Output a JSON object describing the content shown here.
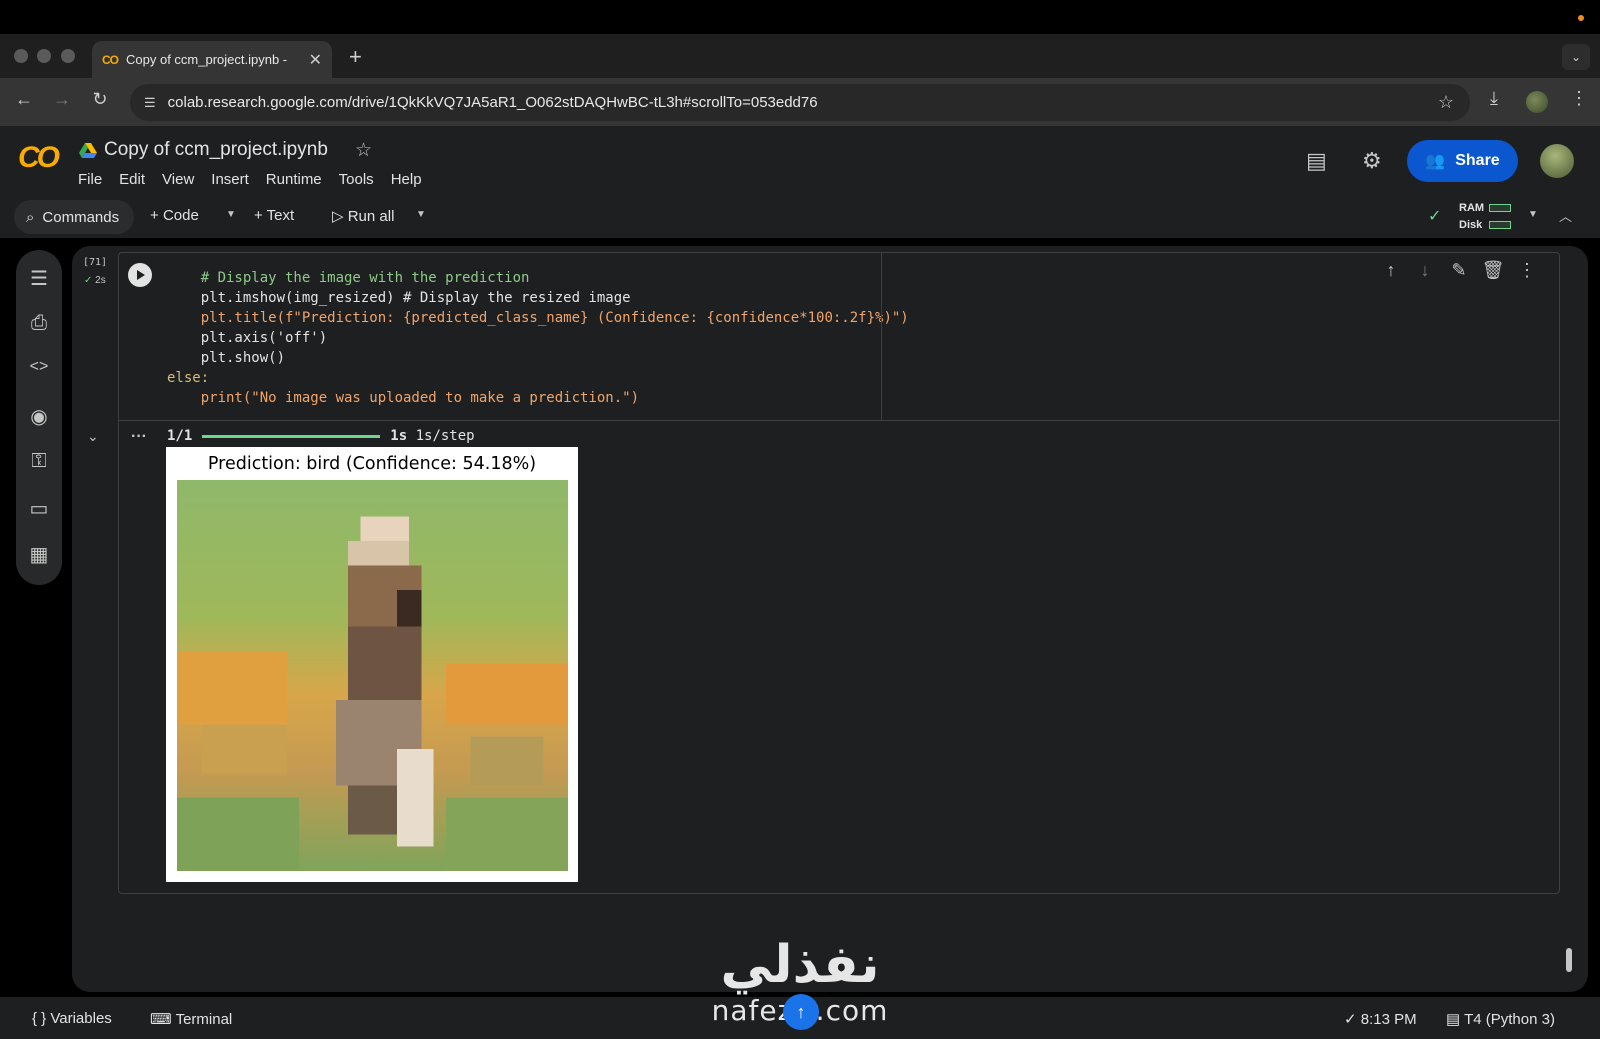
{
  "browser": {
    "tab_title": "Copy of ccm_project.ipynb -",
    "url": "colab.research.google.com/drive/1QkKkVQ7JA5aR1_O062stDAQHwBC-tL3h#scrollTo=053edd76"
  },
  "colab": {
    "logo": "CO",
    "notebook_title": "Copy of ccm_project.ipynb",
    "menu": [
      "File",
      "Edit",
      "View",
      "Insert",
      "Runtime",
      "Tools",
      "Help"
    ],
    "share_label": "Share",
    "toolbar": {
      "commands": "Commands",
      "code": "Code",
      "text": "Text",
      "run_all": "Run all",
      "ram": "RAM",
      "disk": "Disk"
    }
  },
  "cell": {
    "exec_count": "[71]",
    "exec_time": "2s",
    "code_lines": [
      "    # Display the image with the prediction",
      "    plt.imshow(img_resized) # Display the resized image",
      "    plt.title(f\"Prediction: {predicted_class_name} (Confidence: {confidence*100:.2f}%)\")",
      "    plt.axis('off')",
      "    plt.show()",
      "else:",
      "    print(\"No image was uploaded to make a prediction.\")"
    ],
    "output": {
      "step": "1/1",
      "progress": 1.0,
      "time": "1s",
      "rate": "1s/step",
      "plot_title": "Prediction: bird (Confidence: 54.18%)"
    }
  },
  "statusbar": {
    "variables": "Variables",
    "terminal": "Terminal",
    "time": "8:13 PM",
    "runtime": "T4 (Python 3)"
  },
  "watermark": {
    "arabic": "نفذلي",
    "latin": "nafezly.com"
  },
  "colors": {
    "accent_blue": "#0b57d0",
    "colab_orange": "#f9ab00",
    "success_green": "#6dd58c"
  }
}
